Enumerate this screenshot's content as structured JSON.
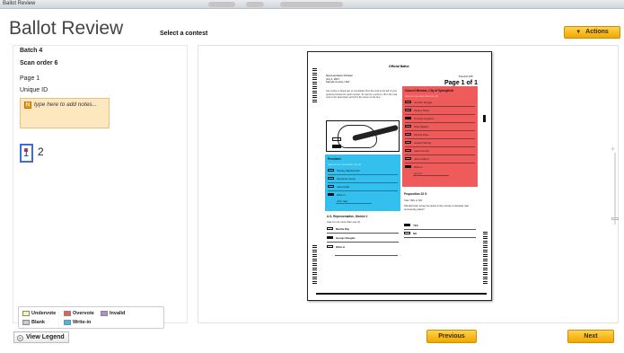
{
  "window": {
    "title": "Ballot Review"
  },
  "header": {
    "app_title": "Ballot Review",
    "select_contest": "Select a contest",
    "actions_label": "Actions"
  },
  "sidebar": {
    "batch": "Batch 4",
    "scan_order": "Scan order 6",
    "page": "Page 1",
    "unique_id": "Unique ID",
    "notes_placeholder": "type here to add notes...",
    "pages": [
      "1",
      "2"
    ]
  },
  "legend": {
    "items": [
      {
        "label": "Undervote",
        "color": "#fff3a0"
      },
      {
        "label": "Overvote",
        "color": "#ef5a5a"
      },
      {
        "label": "Invalid",
        "color": "#b58ad6"
      },
      {
        "label": "Blank",
        "color": "#c9ccd6"
      },
      {
        "label": "Write-in",
        "color": "#33c0ee"
      }
    ],
    "view_legend": "View Legend"
  },
  "ballot": {
    "official": "Official Ballot",
    "header_lines": [
      "Representative Partisan",
      "July 4, 2017",
      "Sample County, USA"
    ],
    "precinct": "Precinct 105",
    "page_label": "Page 1 of 1",
    "instructions": "Use a blue or black pen to completely fill in the oval to the left of your preferred choice for each contest. To vote for a write-in, fill in the oval next to the description and print the name on the line.",
    "contest_red": {
      "title": "Council Member, City of Springfield",
      "sub": "Vote for not more than two (2)",
      "candidates": [
        "Jennifer Spriggs",
        "Wesley Shaw",
        "Timothy Fergusen",
        "Ricky Bigsley",
        "Marcus Rose",
        "Howard Stirling",
        "Aaron Lincoln",
        "Jason Gilbert",
        "Write-in"
      ],
      "writein_text": "q-t-v-t-t"
    },
    "contest_blue": {
      "title": "President",
      "sub": "Vote for not more than one (1)",
      "candidates": [
        "Stanley Washwanski",
        "Damianne Stone",
        "Jacie Keller",
        "Write-in"
      ],
      "writein_text": "John Galt"
    },
    "contest_rep": {
      "title": "U.S. Representative, District 1",
      "sub": "Vote for not more than one (1)",
      "candidates": [
        "Martha Ray",
        "George Douglas",
        "Write-in"
      ]
    },
    "proposition": {
      "title": "Proposition 32 G",
      "sub": "Vote YES or NO",
      "text": "Should local money be spent in the county to develop new community parks?",
      "options": [
        "YES",
        "NO"
      ]
    }
  },
  "nav": {
    "previous": "Previous",
    "next": "Next"
  }
}
